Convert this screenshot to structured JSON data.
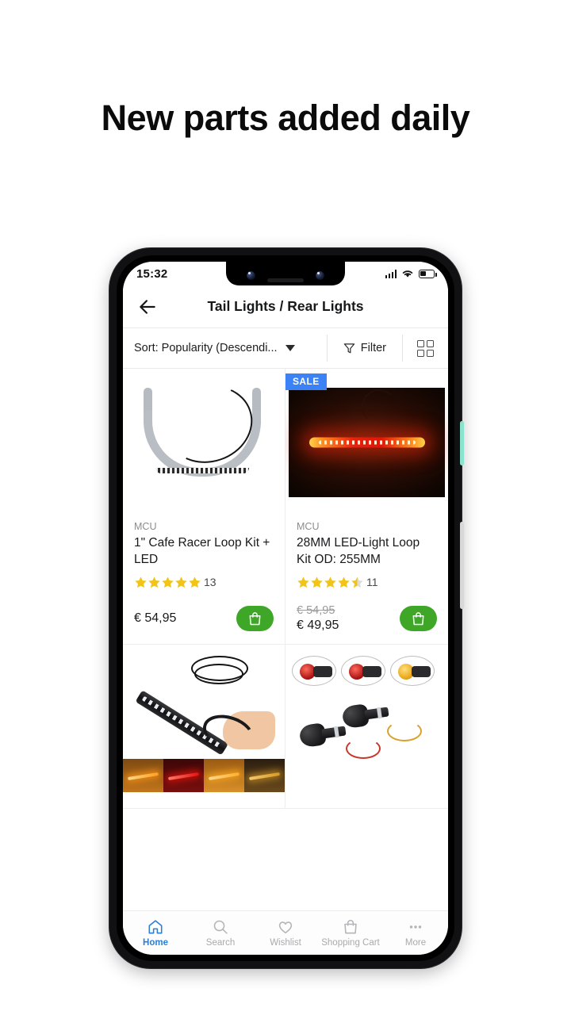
{
  "headline": "New parts added daily",
  "phone": {
    "status_bar": {
      "time": "15:32",
      "signal_icon": "cellular-signal-icon",
      "wifi_icon": "wifi-icon",
      "battery_icon": "battery-icon"
    },
    "app_bar": {
      "back_icon": "back-arrow-icon",
      "title": "Tail Lights / Rear Lights"
    },
    "toolbar": {
      "sort_label": "Sort: Popularity (Descendi...",
      "sort_caret_icon": "chevron-down-icon",
      "filter_label": "Filter",
      "filter_icon": "funnel-icon",
      "grid_view_icon": "grid-view-icon"
    },
    "products": [
      {
        "brand": "MCU",
        "title": "1\" Cafe Racer Loop Kit + LED",
        "rating": 5,
        "reviews": "13",
        "price": "€ 54,95",
        "old_price": "",
        "badge": "",
        "cart_icon": "shopping-bag-icon",
        "image_alt": "chrome-cafe-racer-loop-kit"
      },
      {
        "brand": "MCU",
        "title": "28MM LED-Light Loop Kit OD: 255MM",
        "rating": 4.5,
        "reviews": "11",
        "price": "€ 49,95",
        "old_price": "€ 54,95",
        "badge": "SALE",
        "cart_icon": "shopping-bag-icon",
        "image_alt": "glowing-red-led-light-strip"
      },
      {
        "brand": "",
        "title": "",
        "rating": 0,
        "reviews": "",
        "price": "",
        "old_price": "",
        "badge": "",
        "cart_icon": "",
        "image_alt": "black-flexible-led-strip-with-cable"
      },
      {
        "brand": "",
        "title": "",
        "rating": 0,
        "reviews": "",
        "price": "",
        "old_price": "",
        "badge": "",
        "cart_icon": "",
        "image_alt": "black-bullet-turn-signal-indicators"
      }
    ],
    "tabbar": [
      {
        "label": "Home",
        "icon": "home-icon",
        "active": true
      },
      {
        "label": "Search",
        "icon": "search-icon",
        "active": false
      },
      {
        "label": "Wishlist",
        "icon": "heart-icon",
        "active": false
      },
      {
        "label": "Shopping Cart",
        "icon": "shopping-bag-icon",
        "active": false
      },
      {
        "label": "More",
        "icon": "ellipsis-icon",
        "active": false
      }
    ],
    "hardware": {
      "power_button": "power-button",
      "volume_button": "volume-button",
      "speaker": "speaker-grille"
    }
  },
  "colors": {
    "accent_blue": "#3b82f6",
    "active_tab_blue": "#2b7fd4",
    "star_yellow": "#f0c419",
    "cart_green": "#3ea728",
    "text_dark": "#18191b",
    "text_muted": "#8b8c8f"
  }
}
